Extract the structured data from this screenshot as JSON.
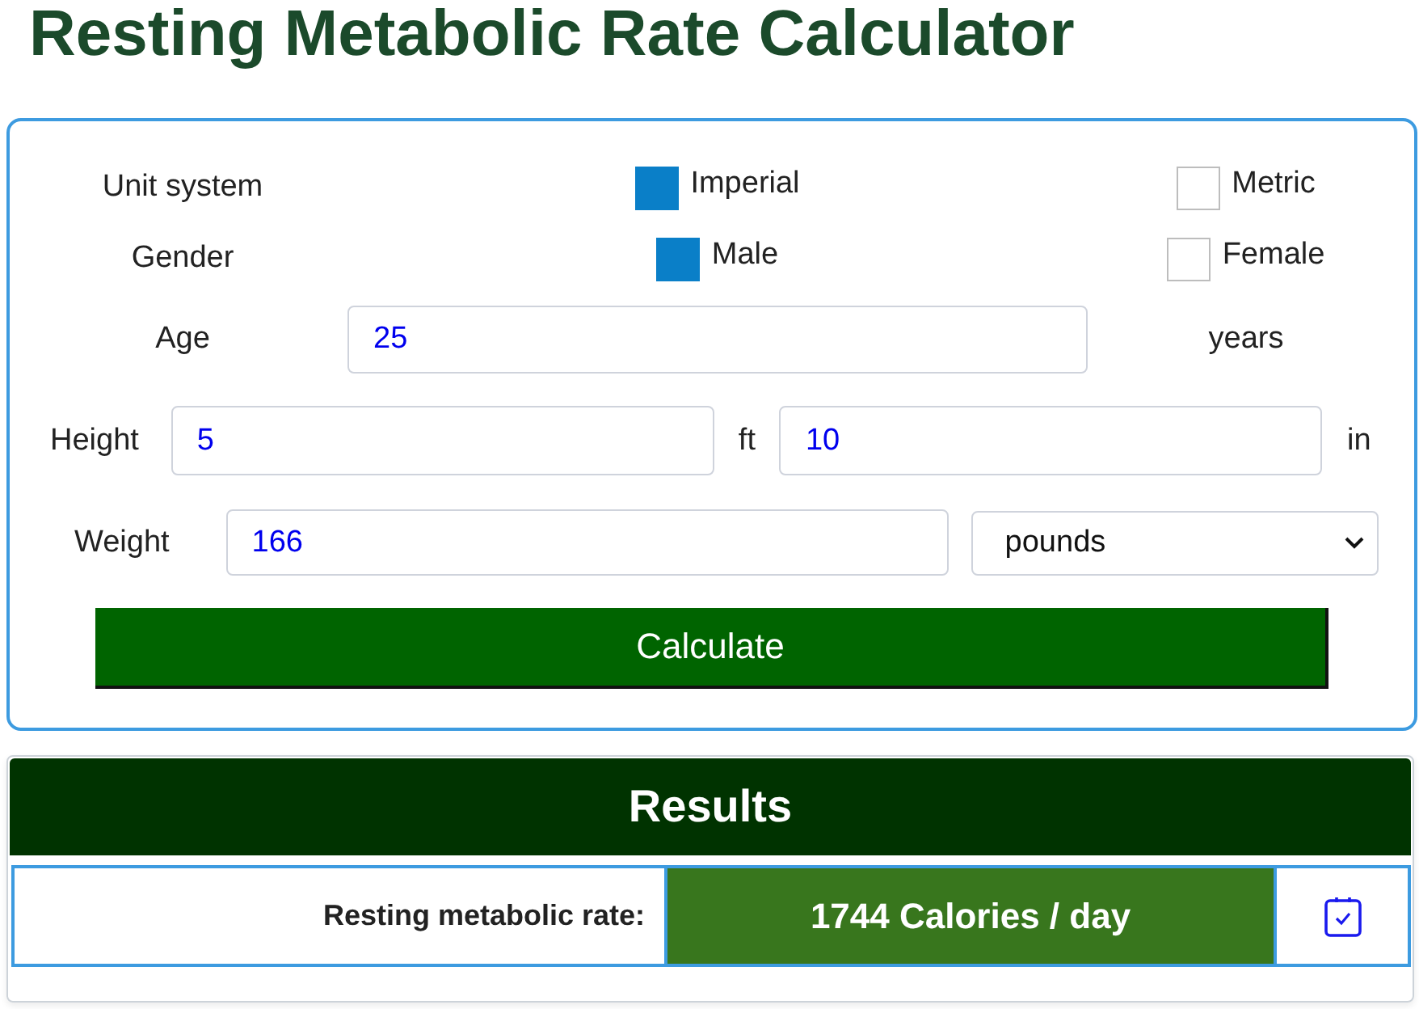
{
  "title": "Resting Metabolic Rate Calculator",
  "form": {
    "unit_system": {
      "label": "Unit system",
      "options": [
        {
          "label": "Imperial",
          "selected": true
        },
        {
          "label": "Metric",
          "selected": false
        }
      ]
    },
    "gender": {
      "label": "Gender",
      "options": [
        {
          "label": "Male",
          "selected": true
        },
        {
          "label": "Female",
          "selected": false
        }
      ]
    },
    "age": {
      "label": "Age",
      "value": "25",
      "unit": "years"
    },
    "height": {
      "label": "Height",
      "feet": {
        "value": "5",
        "unit": "ft"
      },
      "inches": {
        "value": "10",
        "unit": "in"
      }
    },
    "weight": {
      "label": "Weight",
      "value": "166",
      "unit": "pounds"
    },
    "calculate_button": "Calculate"
  },
  "results": {
    "title": "Results",
    "rows": [
      {
        "label": "Resting metabolic rate:",
        "value": "1744 Calories / day"
      }
    ]
  }
}
